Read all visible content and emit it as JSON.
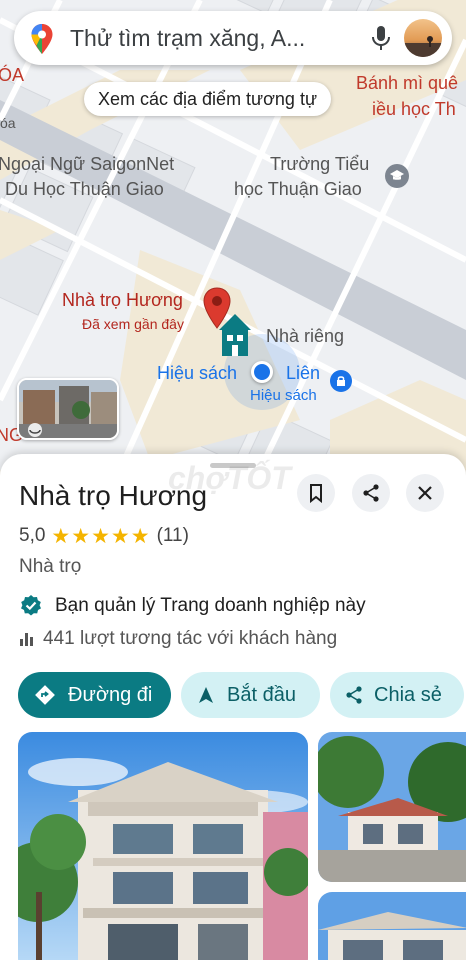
{
  "search": {
    "placeholder": "Thử tìm trạm xăng, A..."
  },
  "similar_chip": "Xem các địa điểm tương tự",
  "map_labels": {
    "edge_top_left": "ÓA",
    "edge_oa": "óa",
    "top_right": "Bánh mì quê",
    "top_right_2": "iều học Th",
    "school_line1": "Trường Tiểu",
    "school_line2": "học Thuận Giao",
    "lang_line1": "Ngoại Ngữ SaigonNet",
    "lang_line2": "- Du Học Thuận Giao",
    "place_name": "Nhà trọ Hương",
    "place_sub": "Đã xem gần đây",
    "private_home": "Nhà riêng",
    "bookstore_name": "Hiệu sách",
    "bookstore_tail": "Liên",
    "bookstore_sub": "Hiệu sách",
    "edge_ng": "NG"
  },
  "watermark": "chợTỐT",
  "place": {
    "title": "Nhà trọ Hương",
    "rating": "5,0",
    "stars": "★★★★★",
    "reviews": "(11)",
    "category": "Nhà trọ",
    "managed_text": "Bạn quản lý Trang doanh nghiệp này",
    "interactions": "441 lượt tương tác với khách hàng"
  },
  "actions": {
    "directions": "Đường đi",
    "start": "Bắt đầu",
    "share": "Chia sẻ"
  },
  "colors": {
    "primary": "#0b7b83",
    "secondary_bg": "#d3f1f4",
    "star": "#f4b400",
    "pin_red": "#db3a2e",
    "location_blue": "#1a73e8"
  },
  "icons": [
    "maps-pin-icon",
    "mic-icon",
    "bookmark-icon",
    "share-icon",
    "close-icon",
    "verified-icon",
    "bar-chart-icon",
    "directions-icon",
    "navigation-arrow-icon",
    "share-icon"
  ]
}
